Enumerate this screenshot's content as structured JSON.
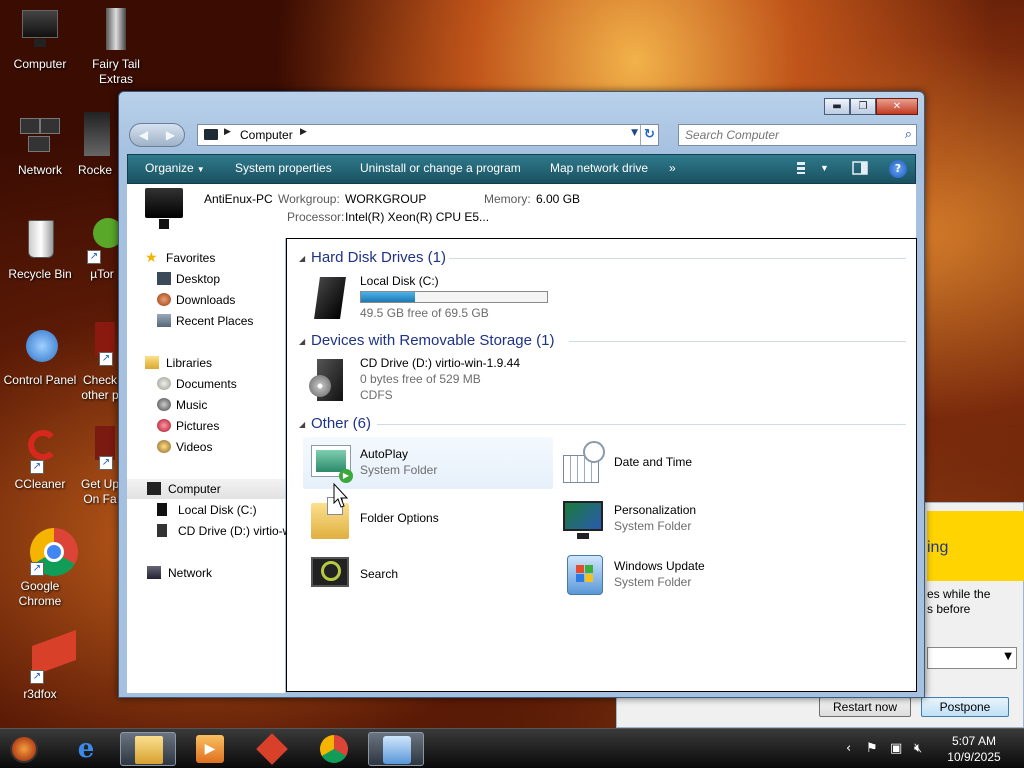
{
  "desktop": {
    "icons": [
      {
        "label": "Computer"
      },
      {
        "label": "Fairy Tail Extras"
      },
      {
        "label": "Network"
      },
      {
        "label": "Rocke"
      },
      {
        "label": "Recycle Bin"
      },
      {
        "label": "µTor"
      },
      {
        "label": "Control Panel"
      },
      {
        "label": "Check other p"
      },
      {
        "label": "CCleaner"
      },
      {
        "label": "Get Up On Fa"
      },
      {
        "label": "Google Chrome"
      },
      {
        "label": "r3dfox"
      }
    ]
  },
  "update_dialog": {
    "heading_fragment": "ing",
    "message_fragment": "es while the\ns before",
    "restart_label": "Restart now",
    "postpone_label": "Postpone"
  },
  "explorer": {
    "address": {
      "segment": "Computer"
    },
    "search": {
      "placeholder": "Search Computer"
    },
    "commands": {
      "organize": "Organize",
      "system_properties": "System properties",
      "uninstall": "Uninstall or change a program",
      "map_drive": "Map network drive",
      "more": "»"
    },
    "details": {
      "pc_name": "AntiEnux-PC",
      "workgroup_label": "Workgroup:",
      "workgroup_value": "WORKGROUP",
      "memory_label": "Memory:",
      "memory_value": "6.00 GB",
      "processor_label": "Processor:",
      "processor_value": "Intel(R) Xeon(R) CPU E5..."
    },
    "nav": {
      "favorites": "Favorites",
      "desktop": "Desktop",
      "downloads": "Downloads",
      "recent": "Recent Places",
      "libraries": "Libraries",
      "documents": "Documents",
      "music": "Music",
      "pictures": "Pictures",
      "videos": "Videos",
      "computer": "Computer",
      "local_disk": "Local Disk (C:)",
      "cd_drive": "CD Drive (D:) virtio-w",
      "network": "Network"
    },
    "groups": {
      "hdd": "Hard Disk Drives (1)",
      "removable": "Devices with Removable Storage (1)",
      "other": "Other (6)"
    },
    "drives": {
      "c_name": "Local Disk (C:)",
      "c_free": "49.5 GB free of 69.5 GB",
      "c_used_fraction": 0.288,
      "d_name": "CD Drive (D:) virtio-win-1.9.44",
      "d_free": "0 bytes free of 529 MB",
      "d_fs": "CDFS"
    },
    "other_items": {
      "autoplay": "AutoPlay",
      "autoplay_sub": "System Folder",
      "date_time": "Date and Time",
      "folder_options": "Folder Options",
      "personalization": "Personalization",
      "personalization_sub": "System Folder",
      "search": "Search",
      "windows_update": "Windows Update",
      "windows_update_sub": "System Folder"
    }
  },
  "taskbar": {
    "time": "5:07 AM",
    "date": "10/9/2025"
  },
  "colors": {
    "command_bar": "#1f5f70",
    "group_heading": "#1e3287",
    "progress_fill": "#1c79b6"
  }
}
